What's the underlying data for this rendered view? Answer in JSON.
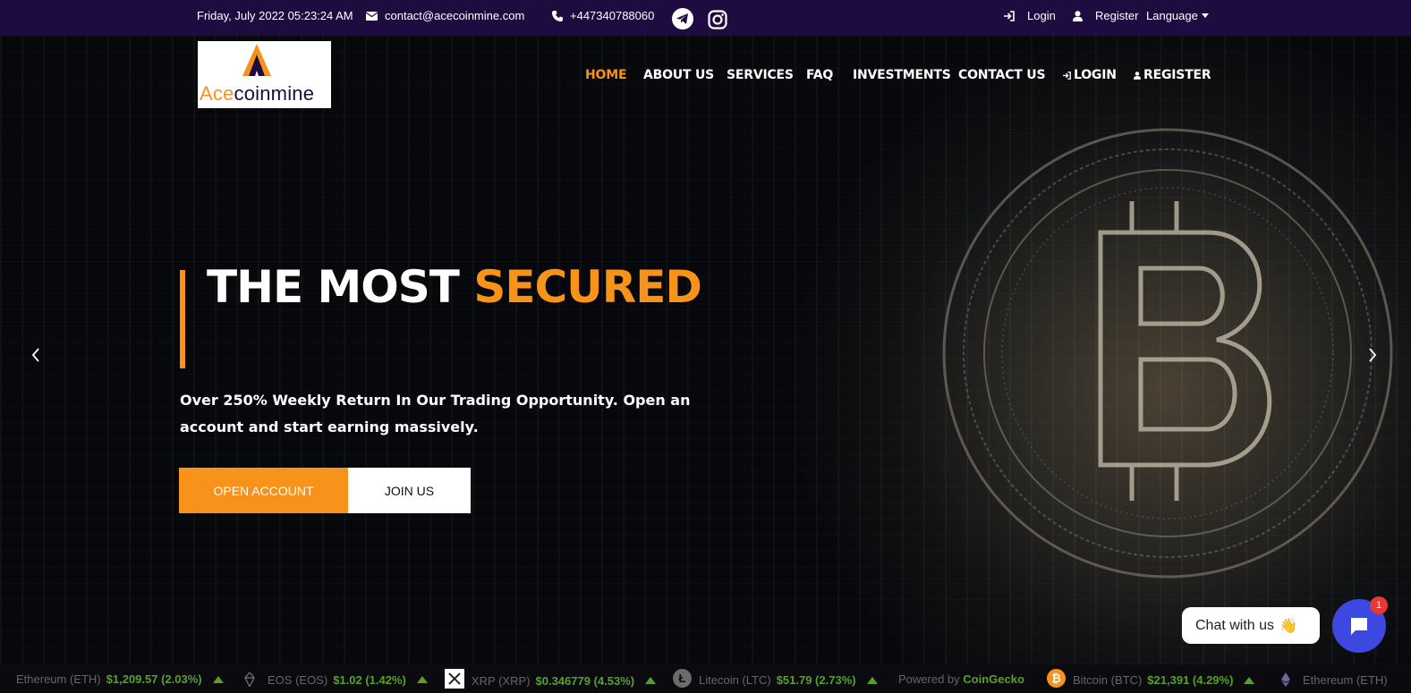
{
  "topbar": {
    "datetime": "Friday, July 2022 05:23:24 AM",
    "email": "contact@acecoinmine.com",
    "phone": "+447340788060",
    "login": "Login",
    "register": "Register",
    "language": "Language"
  },
  "logo": {
    "text_a": "Ace",
    "text_b": "coinmine"
  },
  "nav": [
    "HOME",
    "ABOUT US",
    "SERVICES",
    "FAQ",
    "INVESTMENTS",
    "CONTACT US",
    "LOGIN",
    "REGISTER"
  ],
  "hero": {
    "headline_white": "THE MOST ",
    "headline_orange": "SECURED",
    "subtext": "Over 250% Weekly Return In Our Trading Opportunity. Open an account and start earning massively.",
    "btn_open": "OPEN ACCOUNT",
    "btn_join": "JOIN US"
  },
  "chat": {
    "label": "Chat with us",
    "badge": "1"
  },
  "ticker": [
    {
      "name": "Ethereum (ETH)",
      "price": "$1,209.57 (2.03%)"
    },
    {
      "name": "EOS (EOS)",
      "price": "$1.02 (1.42%)"
    },
    {
      "name": "XRP (XRP)",
      "price": "$0.346779 (4.53%)"
    },
    {
      "name": "Litecoin (LTC)",
      "price": "$51.79 (2.73%)"
    },
    {
      "name": "Bitcoin (BTC)",
      "price": "$21,391 (4.29%)"
    },
    {
      "name": "Ethereum (ETH)",
      "price": ""
    }
  ],
  "powered": {
    "prefix": "Powered by ",
    "brand": "CoinGecko"
  },
  "colors": {
    "accent": "#f7931a",
    "topbar": "#1e0b3f",
    "chat": "#3d48e0",
    "ticker_up": "#57a02f"
  }
}
